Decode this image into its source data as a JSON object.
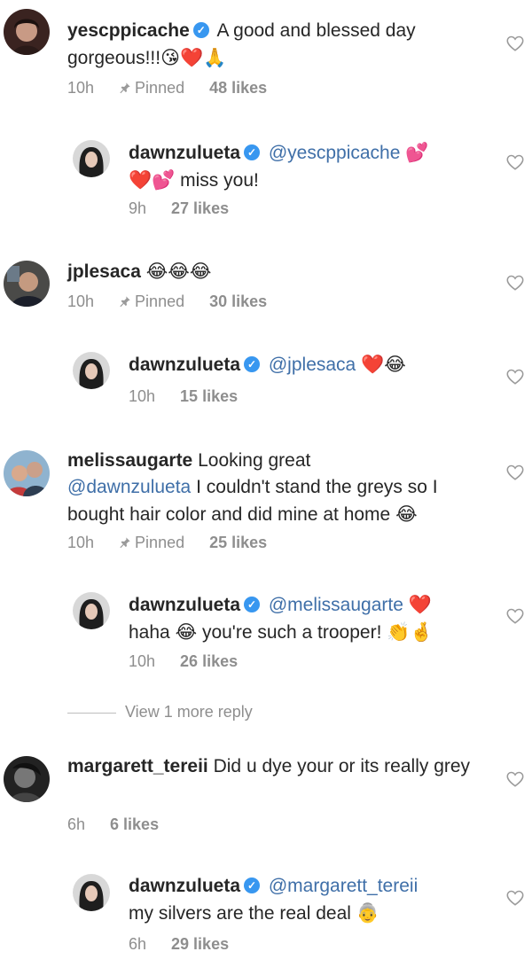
{
  "comments": [
    {
      "avatar_icon": "avatar-yescppicache",
      "username": "yescppicache",
      "verified": true,
      "text": "A good and blessed day gorgeous!!!",
      "emoji": "😘❤️🙏",
      "time": "10h",
      "pinned": "Pinned",
      "likes": "48 likes",
      "reply": {
        "avatar_icon": "avatar-dawnzulueta",
        "username": "dawnzulueta",
        "verified": true,
        "mention": "@yescppicache",
        "emoji_after_mention": "💕",
        "emoji_line2": "❤️💕",
        "text": "miss you!",
        "time": "9h",
        "likes": "27 likes"
      }
    },
    {
      "avatar_icon": "avatar-jplesaca",
      "username": "jplesaca",
      "verified": false,
      "emoji": "😂😂😂",
      "time": "10h",
      "pinned": "Pinned",
      "likes": "30 likes",
      "reply": {
        "avatar_icon": "avatar-dawnzulueta",
        "username": "dawnzulueta",
        "verified": true,
        "mention": "@jplesaca",
        "emoji": "❤️😂",
        "time": "10h",
        "likes": "15 likes"
      }
    },
    {
      "avatar_icon": "avatar-melissaugarte",
      "username": "melissaugarte",
      "verified": false,
      "text_a": "Looking great",
      "mention": "@dawnzulueta",
      "text_b": "I couldn't stand the greys so I bought hair color and did mine at home",
      "emoji": "😂",
      "time": "10h",
      "pinned": "Pinned",
      "likes": "25 likes",
      "reply": {
        "avatar_icon": "avatar-dawnzulueta",
        "username": "dawnzulueta",
        "verified": true,
        "mention": "@melissaugarte",
        "emoji_after_mention": "❤️",
        "text_a": "haha",
        "emoji_mid": "😂",
        "text_b": "you're such a trooper!",
        "emoji_end": "👏🤞",
        "time": "10h",
        "likes": "26 likes"
      },
      "view_more": "View 1 more reply"
    },
    {
      "avatar_icon": "avatar-margarett-tereii",
      "username": "margarett_tereii",
      "verified": false,
      "text": "Did u dye your or its really grey",
      "time": "6h",
      "likes": "6 likes",
      "reply": {
        "avatar_icon": "avatar-dawnzulueta",
        "username": "dawnzulueta",
        "verified": true,
        "mention": "@margarett_tereii",
        "text": "my silvers are the real deal",
        "emoji": "👵",
        "time": "6h",
        "likes": "29 likes"
      }
    }
  ],
  "icons": {
    "verified": "verified-badge-icon",
    "pin": "pin-icon",
    "like": "heart-outline-icon"
  },
  "colors": {
    "text": "#262626",
    "meta": "#8e8e8e",
    "mention": "#3f6fa8",
    "verified": "#3897f0"
  }
}
